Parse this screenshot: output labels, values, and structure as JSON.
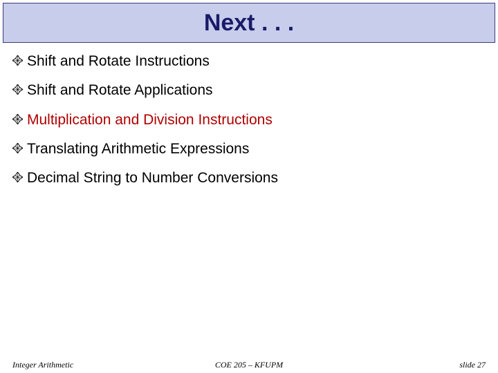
{
  "title": "Next . . .",
  "items": [
    {
      "text": "Shift and Rotate Instructions",
      "highlight": false
    },
    {
      "text": "Shift and Rotate Applications",
      "highlight": false
    },
    {
      "text": "Multiplication and Division Instructions",
      "highlight": true
    },
    {
      "text": "Translating Arithmetic Expressions",
      "highlight": false
    },
    {
      "text": "Decimal String to Number Conversions",
      "highlight": false
    }
  ],
  "footer": {
    "left": "Integer Arithmetic",
    "center": "COE 205 – KFUPM",
    "right": "slide 27"
  }
}
